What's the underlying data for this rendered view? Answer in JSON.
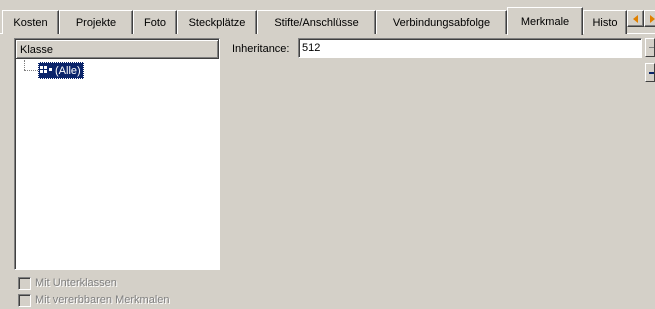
{
  "tabs": [
    {
      "label": "Kosten",
      "active": false
    },
    {
      "label": "Projekte",
      "active": false
    },
    {
      "label": "Foto",
      "active": false
    },
    {
      "label": "Steckplätze",
      "active": false
    },
    {
      "label": "Stifte/Anschlüsse",
      "active": false
    },
    {
      "label": "Verbindungsabfolge",
      "active": false
    },
    {
      "label": "Merkmale",
      "active": true
    },
    {
      "label": "Histo",
      "active": false
    }
  ],
  "tab_scroll": {
    "left_icon": "arrow-left-icon",
    "right_icon": "arrow-right-icon"
  },
  "tree": {
    "header": "Klasse",
    "nodes": [
      {
        "label": "(Alle)",
        "selected": true,
        "icon": "class-group-icon"
      }
    ]
  },
  "inheritance": {
    "label": "Inheritance:",
    "value": "512"
  },
  "checkboxes": [
    {
      "label": "Mit Unterklassen",
      "checked": false,
      "enabled": false
    },
    {
      "label": "Mit vererbbaren Merkmalen",
      "checked": false,
      "enabled": false
    }
  ],
  "colors": {
    "face": "#d4d0c8",
    "selection": "#0a246a",
    "scroll_arrow": "#e08000",
    "disabled_text": "#808080"
  }
}
